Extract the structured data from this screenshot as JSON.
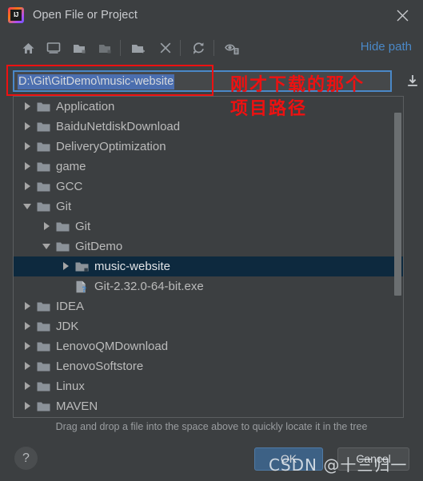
{
  "window": {
    "title": "Open File or Project",
    "app_icon": "intellij-idea-logo",
    "close_icon": "close-icon"
  },
  "toolbar": {
    "items": [
      {
        "name": "home-icon",
        "tooltip": "Home"
      },
      {
        "name": "desktop-icon",
        "tooltip": "Desktop"
      },
      {
        "name": "folder-up-icon",
        "tooltip": "Up"
      },
      {
        "name": "folder-icon",
        "tooltip": "Project Directory"
      },
      {
        "name": "new-folder-icon",
        "tooltip": "New Folder"
      },
      {
        "name": "delete-icon",
        "tooltip": "Delete"
      },
      {
        "name": "refresh-icon",
        "tooltip": "Refresh"
      },
      {
        "name": "show-hidden-icon",
        "tooltip": "Show Hidden Files"
      }
    ],
    "hide_path_label": "Hide path"
  },
  "path_field": {
    "value": "D:\\Git\\GitDemo\\music-website",
    "placeholder": "",
    "selected": true,
    "dropdown_icon": "download-arrow-icon"
  },
  "annotation": {
    "line1": "刚才下载的那个",
    "line2": "项目路径",
    "color": "#ee1111"
  },
  "tree": {
    "rows": [
      {
        "label": "Application",
        "indent": 0,
        "arrow": "right",
        "icon": "folder-icon",
        "selected": false
      },
      {
        "label": "BaiduNetdiskDownload",
        "indent": 0,
        "arrow": "right",
        "icon": "folder-icon",
        "selected": false
      },
      {
        "label": "DeliveryOptimization",
        "indent": 0,
        "arrow": "right",
        "icon": "folder-icon",
        "selected": false
      },
      {
        "label": "game",
        "indent": 0,
        "arrow": "right",
        "icon": "folder-icon",
        "selected": false
      },
      {
        "label": "GCC",
        "indent": 0,
        "arrow": "right",
        "icon": "folder-icon",
        "selected": false
      },
      {
        "label": "Git",
        "indent": 0,
        "arrow": "down",
        "icon": "folder-icon",
        "selected": false
      },
      {
        "label": "Git",
        "indent": 1,
        "arrow": "right",
        "icon": "folder-icon",
        "selected": false
      },
      {
        "label": "GitDemo",
        "indent": 1,
        "arrow": "down",
        "icon": "folder-icon",
        "selected": false
      },
      {
        "label": "music-website",
        "indent": 2,
        "arrow": "right",
        "icon": "folder-module-icon",
        "selected": true
      },
      {
        "label": "Git-2.32.0-64-bit.exe",
        "indent": 2,
        "arrow": "none",
        "icon": "unknown-file-icon",
        "selected": false
      },
      {
        "label": "IDEA",
        "indent": 0,
        "arrow": "right",
        "icon": "folder-icon",
        "selected": false
      },
      {
        "label": "JDK",
        "indent": 0,
        "arrow": "right",
        "icon": "folder-icon",
        "selected": false
      },
      {
        "label": "LenovoQMDownload",
        "indent": 0,
        "arrow": "right",
        "icon": "folder-icon",
        "selected": false
      },
      {
        "label": "LenovoSoftstore",
        "indent": 0,
        "arrow": "right",
        "icon": "folder-icon",
        "selected": false
      },
      {
        "label": "Linux",
        "indent": 0,
        "arrow": "right",
        "icon": "folder-icon",
        "selected": false
      },
      {
        "label": "MAVEN",
        "indent": 0,
        "arrow": "right",
        "icon": "folder-icon",
        "selected": false
      },
      {
        "label": "",
        "indent": 0,
        "arrow": "right",
        "icon": "folder-icon",
        "selected": false
      }
    ],
    "scrollbar": {
      "thumb_top_pct": 5,
      "thumb_height_pct": 57
    }
  },
  "footer": {
    "hint": "Drag and drop a file into the space above to quickly locate it in the tree",
    "help_label": "?",
    "ok_label": "OK",
    "cancel_label": "Cancel"
  },
  "watermark": {
    "text": "CSDN @十三归一"
  },
  "colors": {
    "background": "#3c3f41",
    "selection": "#0d293e",
    "accent_blue": "#4a88c7",
    "text_selection": "#4b6eaf",
    "annotation_red": "#ee1111",
    "ok_button": "#3d6185"
  }
}
